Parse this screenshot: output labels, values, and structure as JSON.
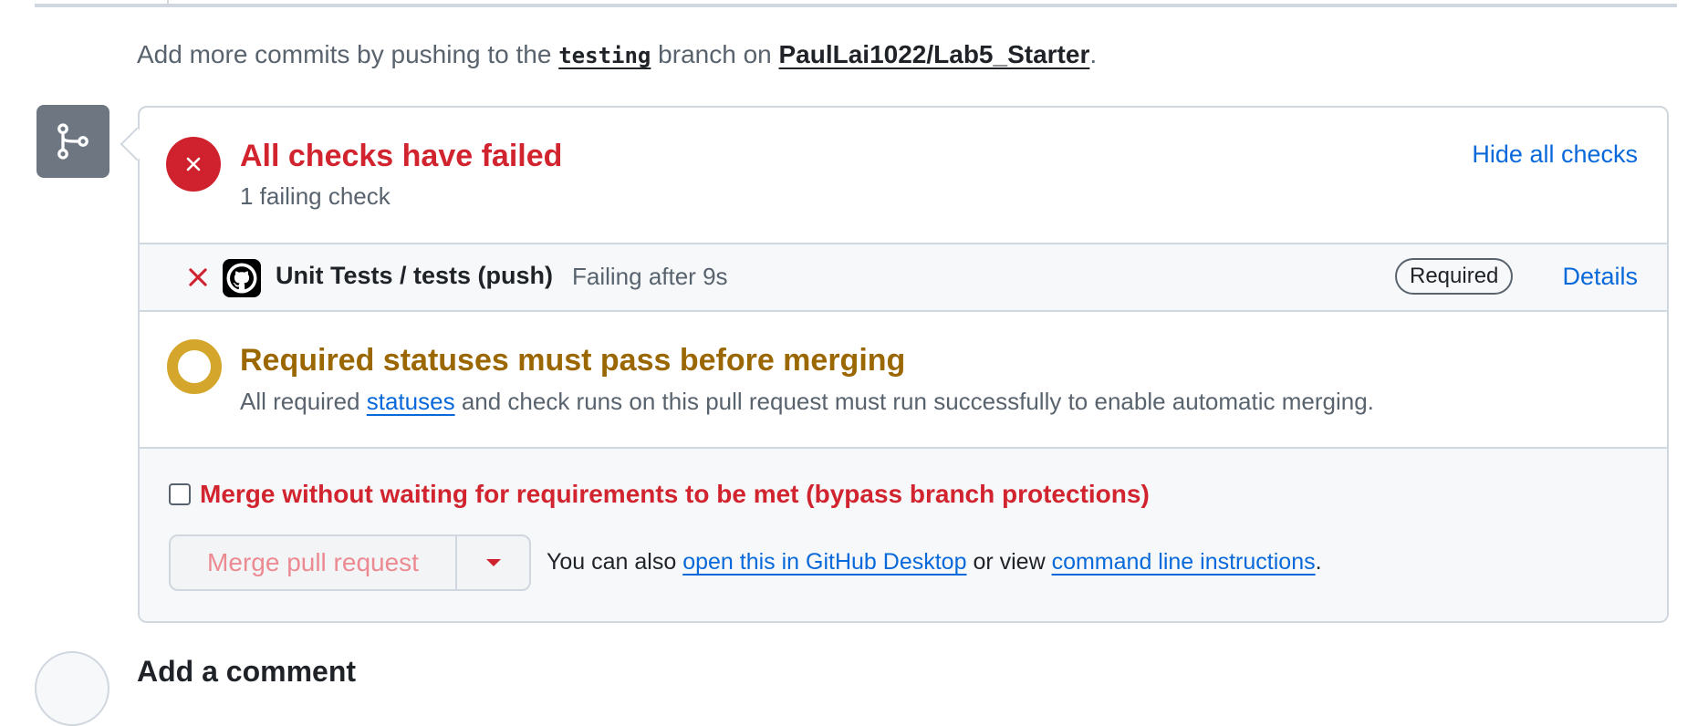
{
  "push_note": {
    "prefix": "Add more commits by pushing to the",
    "branch": "testing",
    "middle": "branch on",
    "repo": "PaulLai1022/Lab5_Starter",
    "suffix": "."
  },
  "checks": {
    "title": "All checks have failed",
    "subtitle": "1 failing check",
    "hide_label": "Hide all checks",
    "items": [
      {
        "name": "Unit Tests / tests (push)",
        "status": "Failing after 9s",
        "badge": "Required",
        "details_label": "Details"
      }
    ]
  },
  "required": {
    "title": "Required statuses must pass before merging",
    "sub_prefix": "All required",
    "sub_link": "statuses",
    "sub_suffix": "and check runs on this pull request must run successfully to enable automatic merging."
  },
  "merge": {
    "bypass_label": "Merge without waiting for requirements to be met (bypass branch protections)",
    "bypass_checked": false,
    "button_label": "Merge pull request",
    "also_prefix": "You can also",
    "desktop_link": "open this in GitHub Desktop",
    "also_middle": "or view",
    "cli_link": "command line instructions",
    "also_suffix": "."
  },
  "comment": {
    "title": "Add a comment"
  },
  "colors": {
    "danger": "#d1242f",
    "warning": "#9a6700",
    "pending_ring": "#d4a72c",
    "link": "#0969da",
    "border": "#d0d7de"
  },
  "icons": [
    "git-branch-icon",
    "x-circle-icon",
    "x-icon",
    "github-mark-icon",
    "pending-ring-icon",
    "triangle-down-icon"
  ]
}
